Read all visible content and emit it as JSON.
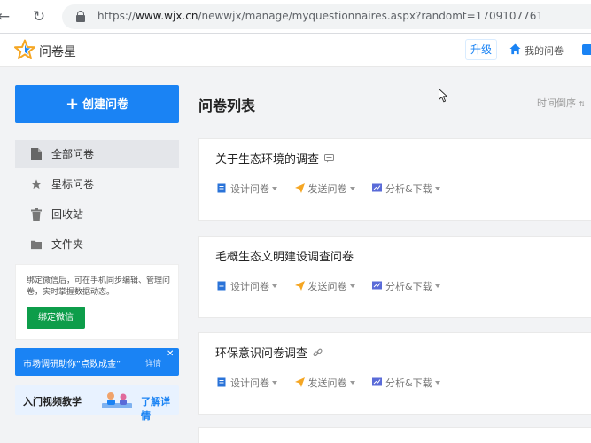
{
  "browser": {
    "url_host": "www.wjx.cn",
    "url_path": "/newwjx/manage/myquestionnaires.aspx?randomt=1709107761",
    "url_prefix": "https://"
  },
  "header": {
    "brand": "问卷星",
    "upgrade_label": "升级",
    "my_questionnaires_label": "我的问卷"
  },
  "sidebar": {
    "create_label": "创建问卷",
    "items": [
      {
        "label": "全部问卷",
        "icon": "document-icon",
        "active": true
      },
      {
        "label": "星标问卷",
        "icon": "star-icon",
        "active": false
      },
      {
        "label": "回收站",
        "icon": "trash-icon",
        "active": false
      },
      {
        "label": "文件夹",
        "icon": "folder-icon",
        "active": false
      }
    ],
    "bind_wechat": {
      "text": "绑定微信后，可在手机同步编辑、管理问卷，实时掌握数据动态。",
      "button_label": "绑定微信"
    },
    "promo": {
      "text": "市场调研助你“点数成金”",
      "detail_label": "详情"
    },
    "video": {
      "text": "入门视频教学",
      "more_label": "了解详情"
    }
  },
  "main": {
    "title": "问卷列表",
    "sort_label": "时间倒序",
    "actions": [
      "设计问卷",
      "发送问卷",
      "分析&下载"
    ],
    "questionnaires": [
      {
        "title": "关于生态环境的调查",
        "icon": "chat-icon"
      },
      {
        "title": "毛概生态文明建设调查问卷",
        "icon": ""
      },
      {
        "title": "环保意识问卷调查",
        "icon": "link-icon"
      }
    ]
  },
  "colors": {
    "primary": "#1a83f4",
    "wechat_green": "#0d9d4a",
    "background": "#f2f3f5"
  }
}
